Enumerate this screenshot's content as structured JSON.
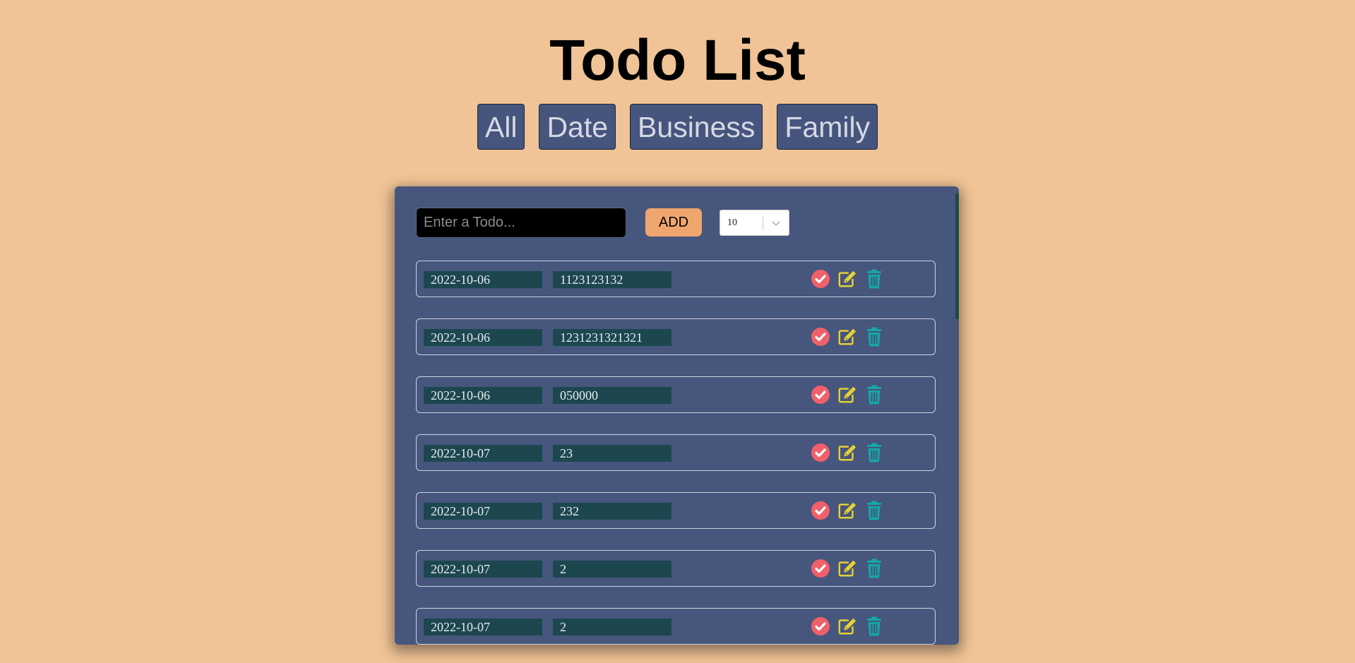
{
  "page": {
    "title": "Todo List"
  },
  "filters": [
    {
      "label": "All"
    },
    {
      "label": "Date"
    },
    {
      "label": "Business"
    },
    {
      "label": "Family"
    }
  ],
  "form": {
    "input_placeholder": "Enter a Todo...",
    "input_value": "",
    "add_label": "ADD",
    "limit_value": "10"
  },
  "todos": [
    {
      "date": "2022-10-06",
      "text": "1123123132"
    },
    {
      "date": "2022-10-06",
      "text": "1231231321321"
    },
    {
      "date": "2022-10-06",
      "text": "050000"
    },
    {
      "date": "2022-10-07",
      "text": "23"
    },
    {
      "date": "2022-10-07",
      "text": "232"
    },
    {
      "date": "2022-10-07",
      "text": "2"
    },
    {
      "date": "2022-10-07",
      "text": "2"
    }
  ],
  "icons": {
    "complete": "check-circle-icon",
    "edit": "edit-icon",
    "delete": "trash-icon",
    "dropdown": "chevron-down-icon"
  },
  "colors": {
    "background": "#f0c496",
    "panel": "#46567d",
    "add_button": "#efa66e",
    "cell": "#1c474f",
    "complete_icon": "#f0606a",
    "edit_icon": "#e6d032",
    "delete_icon": "#14a7a7"
  }
}
